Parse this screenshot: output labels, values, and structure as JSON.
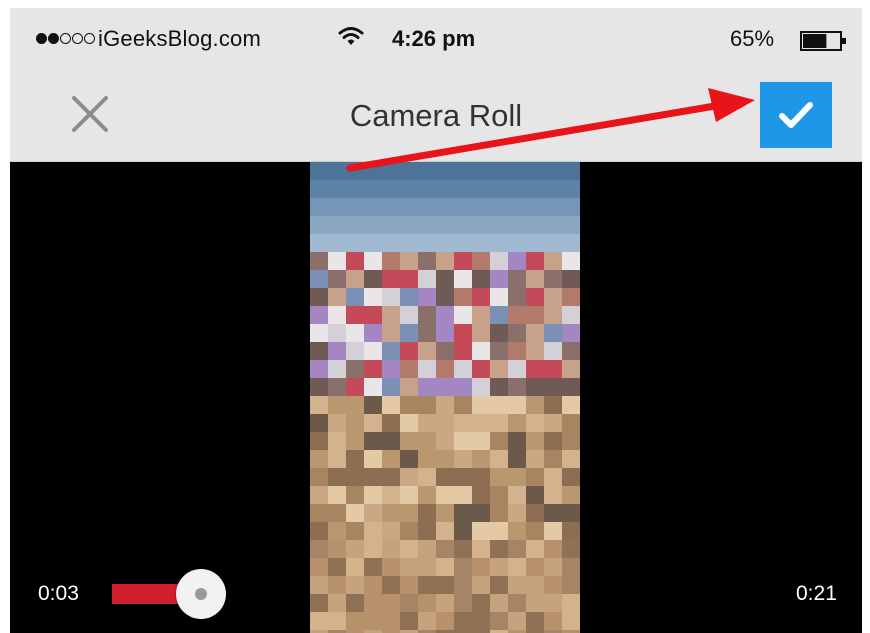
{
  "status_bar": {
    "carrier": "iGeeksBlog.com",
    "time": "4:26 pm",
    "battery": "65%",
    "signal_bars_filled": 2,
    "signal_bars_total": 5,
    "battery_level": 0.65
  },
  "nav": {
    "title": "Camera Roll",
    "close_icon": "close-icon",
    "confirm_icon": "checkmark-icon"
  },
  "player": {
    "current_time": "0:03",
    "duration": "0:21",
    "progress": 0.14
  },
  "colors": {
    "accent": "#1e97e8",
    "progress": "#d21f30",
    "annotation_arrow": "#e8141a"
  }
}
